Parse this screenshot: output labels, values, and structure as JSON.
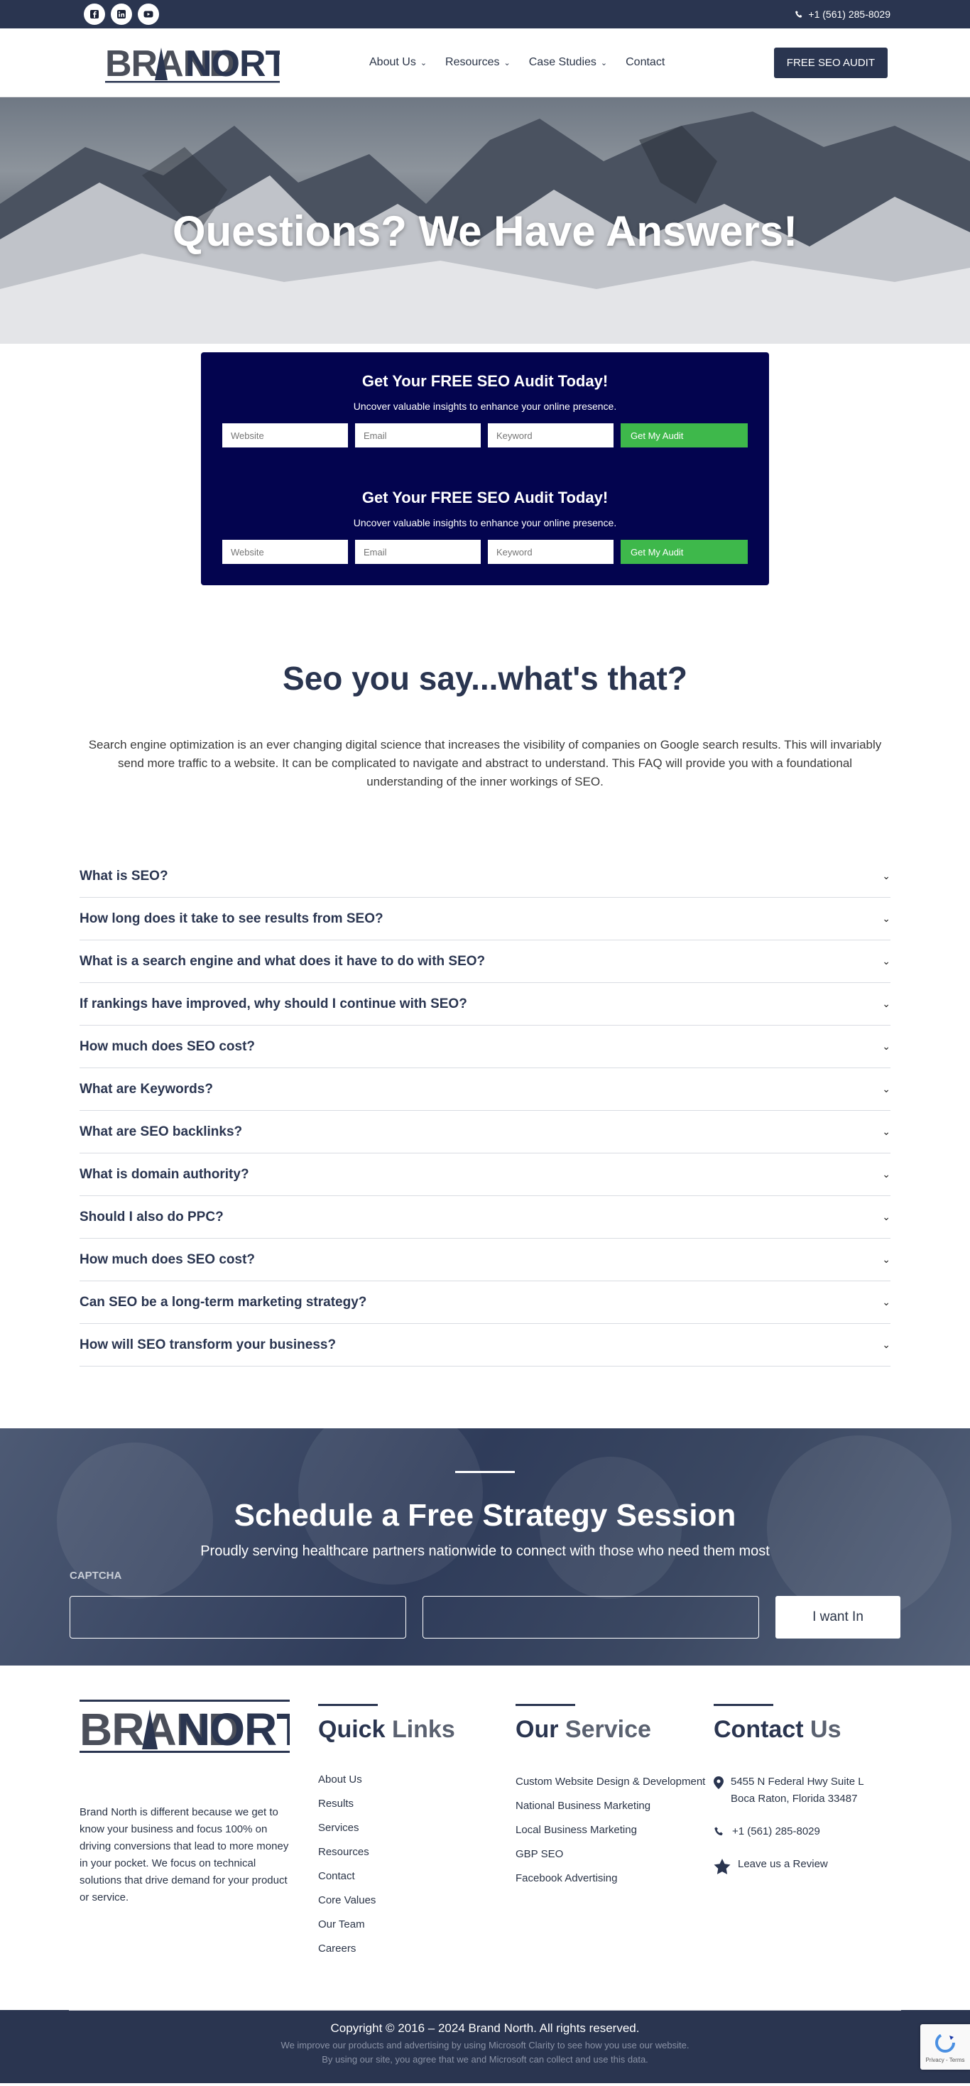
{
  "topbar": {
    "phone": "+1 (561) 285-8029"
  },
  "header": {
    "logo_left": "BRAND",
    "logo_right": "NORTH",
    "nav": [
      {
        "label": "About Us",
        "has_menu": true
      },
      {
        "label": "Resources",
        "has_menu": true
      },
      {
        "label": "Case Studies",
        "has_menu": true
      },
      {
        "label": "Contact",
        "has_menu": false
      }
    ],
    "cta": "FREE SEO AUDIT"
  },
  "hero": {
    "title": "Questions? We Have Answers!"
  },
  "audit": [
    {
      "title": "Get Your FREE SEO Audit Today!",
      "subtitle": "Uncover valuable insights to enhance your online presence.",
      "website_placeholder": "Website",
      "email_placeholder": "Email",
      "keyword_placeholder": "Keyword",
      "submit": "Get My Audit"
    },
    {
      "title": "Get Your FREE SEO Audit Today!",
      "subtitle": "Uncover valuable insights to enhance your online presence.",
      "website_placeholder": "Website",
      "email_placeholder": "Email",
      "keyword_placeholder": "Keyword",
      "submit": "Get My Audit"
    }
  ],
  "intro": {
    "heading": "Seo you say...what's that?",
    "text": "Search engine optimization is an ever changing digital science that increases the visibility of companies on Google search results. This will invariably send more traffic to a website. It can be complicated to navigate and abstract to understand. This FAQ will provide you with a foundational understanding of the inner workings of SEO."
  },
  "faq": [
    "What is SEO?",
    "How long does it take to see results from SEO?",
    "What is a search engine and what does it have to do with SEO?",
    "If rankings have improved, why should I continue with SEO?",
    "How much does SEO cost?",
    "What are Keywords?",
    "What are SEO backlinks?",
    "What is domain authority?",
    "Should I also do PPC?",
    "How much does SEO cost?",
    "Can SEO be a long-term marketing strategy?",
    "How will SEO transform your business?"
  ],
  "session": {
    "title": "Schedule a Free Strategy Session",
    "subtitle": "Proudly serving healthcare partners nationwide to connect with those who need them most",
    "captcha_label": "CAPTCHA",
    "submit": "I want In"
  },
  "footer": {
    "about": "Brand North is different because we get to know your business and focus 100% on driving conversions that lead to more money in your pocket. We focus on technical solutions that drive demand for your product or service.",
    "links_title_a": "Quick",
    "links_title_b": "Links",
    "links": [
      "About Us",
      "Results",
      "Services",
      "Resources",
      "Contact",
      "Core Values",
      "Our Team",
      "Careers"
    ],
    "service_title_a": "Our",
    "service_title_b": "Service",
    "services": [
      "Custom Website Design & Development",
      "National Business Marketing",
      "Local Business Marketing",
      "GBP SEO",
      "Facebook Advertising"
    ],
    "contact_title_a": "Contact",
    "contact_title_b": "Us",
    "address": "5455 N Federal Hwy Suite L Boca Raton, Florida 33487",
    "phone": "+1 (561) 285-8029",
    "review": "Leave us a Review"
  },
  "bottom": {
    "copyright": "Copyright © 2016 – 2024 Brand North. All rights reserved.",
    "notice_1": "We improve our products and advertising by using Microsoft Clarity to see how you use our website.",
    "notice_2": "By using our site, you agree that we and Microsoft can collect and use this data.",
    "recaptcha_terms": "Privacy - Terms"
  }
}
